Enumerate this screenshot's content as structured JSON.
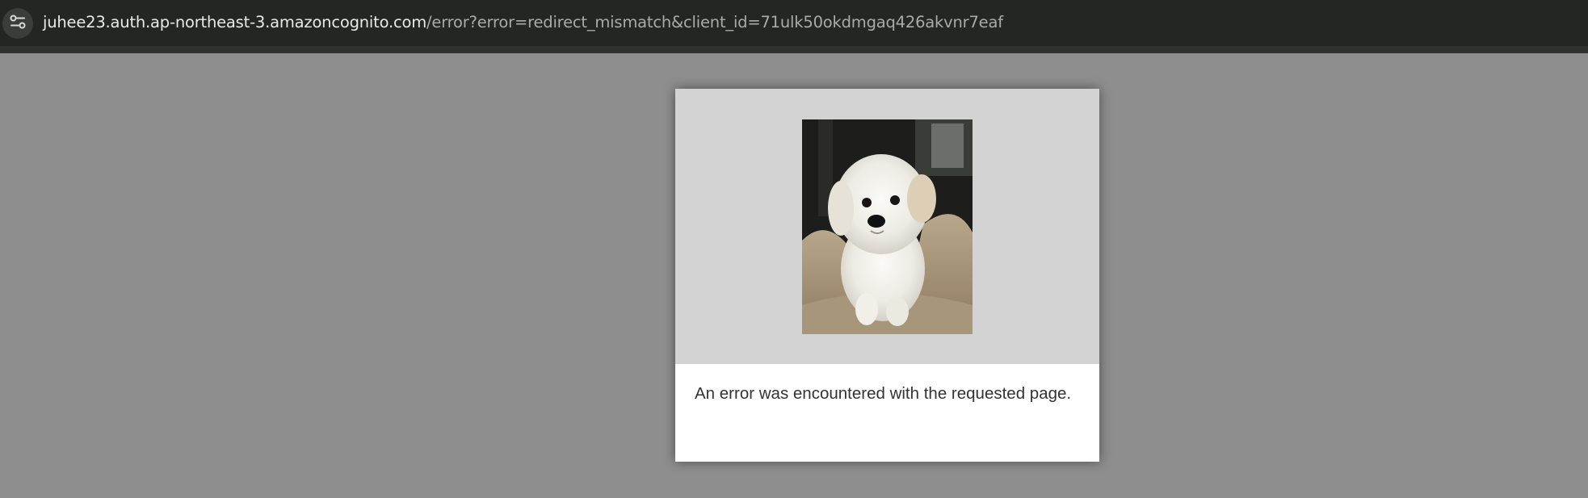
{
  "browser": {
    "url_host": "juhee23.auth.ap-northeast-3.amazoncognito.com",
    "url_path": "/error?error=redirect_mismatch&client_id=71ulk50okdmgaq426akvnr7eaf",
    "site_info_icon": "tune-icon"
  },
  "error_page": {
    "logo_image": "white-puppy-photo",
    "message": "An error was encountered with the requested page."
  },
  "colors": {
    "page_background": "#8e8e8e",
    "banner_background": "#d3d3d3",
    "card_background": "#ffffff",
    "toolbar_background": "#232622"
  }
}
